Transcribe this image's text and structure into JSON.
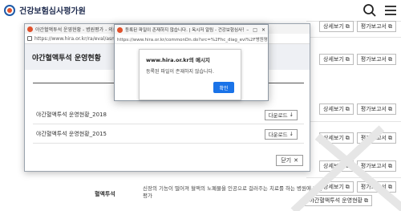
{
  "site": {
    "logo_text": "건강보험심사평가원",
    "row_buttons": [
      {
        "detail": "상세보기",
        "report": "평가보고서"
      },
      {
        "detail": "상세보기",
        "report": "평가보고서"
      },
      {
        "detail": "상세보기",
        "report": "평가보고서"
      },
      {
        "detail": "상세보기",
        "report": "평가보고서"
      },
      {
        "detail": "상세보기",
        "report": "평가보고서"
      },
      {
        "detail": "상세보기",
        "report": "평가보고서"
      }
    ],
    "bottom_row": {
      "label": "혈액투석",
      "description": "신장의 기능이 떨어져 혈액의 노폐물을 인공으로 걸러주는 치료를 하는 병원에 대한 평가",
      "status_button": "야간혈액투석 운영현황"
    }
  },
  "popup": {
    "window_title": "야간혈액투석 운영현황 - 병원평가 - 의료정보 - ...",
    "address": "https://www.hira.or.kr/ra/eval/asmInfo...",
    "banner_title": "야간혈액투석 운영현황",
    "files": [
      {
        "name": "야간혈액투석 운영현황_2018",
        "button": "다운로드"
      },
      {
        "name": "야간혈액투석 운영현황_2015",
        "button": "다운로드"
      }
    ],
    "close_label": "닫기"
  },
  "alert": {
    "window_title": "등록된 파일이 존재하지 않습니다. | 옥시저 알림 - 건강보험심사평가원 - 프로필 1 - ...",
    "address": "https://www.hira.or.kr/commonDn.do?src=%2Fhc_diag_evl%2F병원평가결과보고서...",
    "host_message": "www.hira.or.kr의 메시지",
    "message": "등록된 파일이 존재하지 않습니다.",
    "ok_label": "확인"
  }
}
